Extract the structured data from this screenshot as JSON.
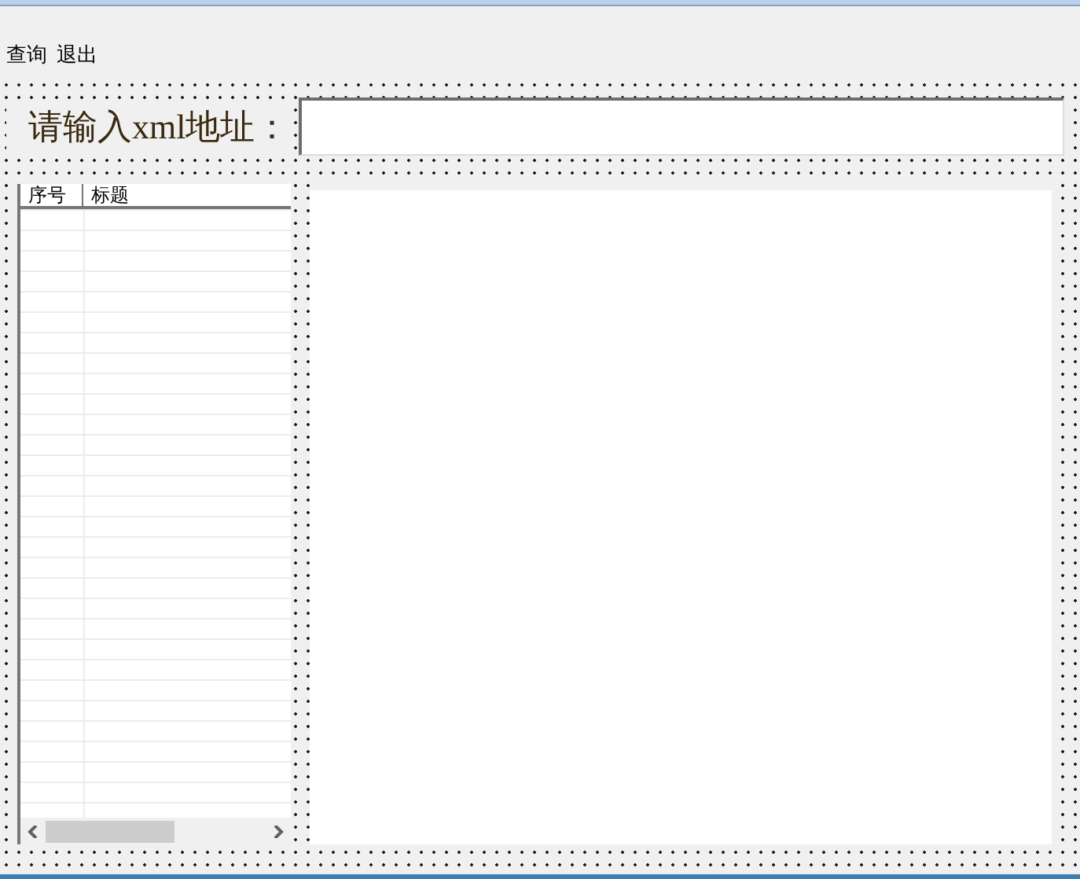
{
  "menu": [
    "查询",
    "退出"
  ],
  "address": {
    "label": "请输入xml地址："
  },
  "list": {
    "columns": [
      "序号",
      "标题"
    ]
  }
}
